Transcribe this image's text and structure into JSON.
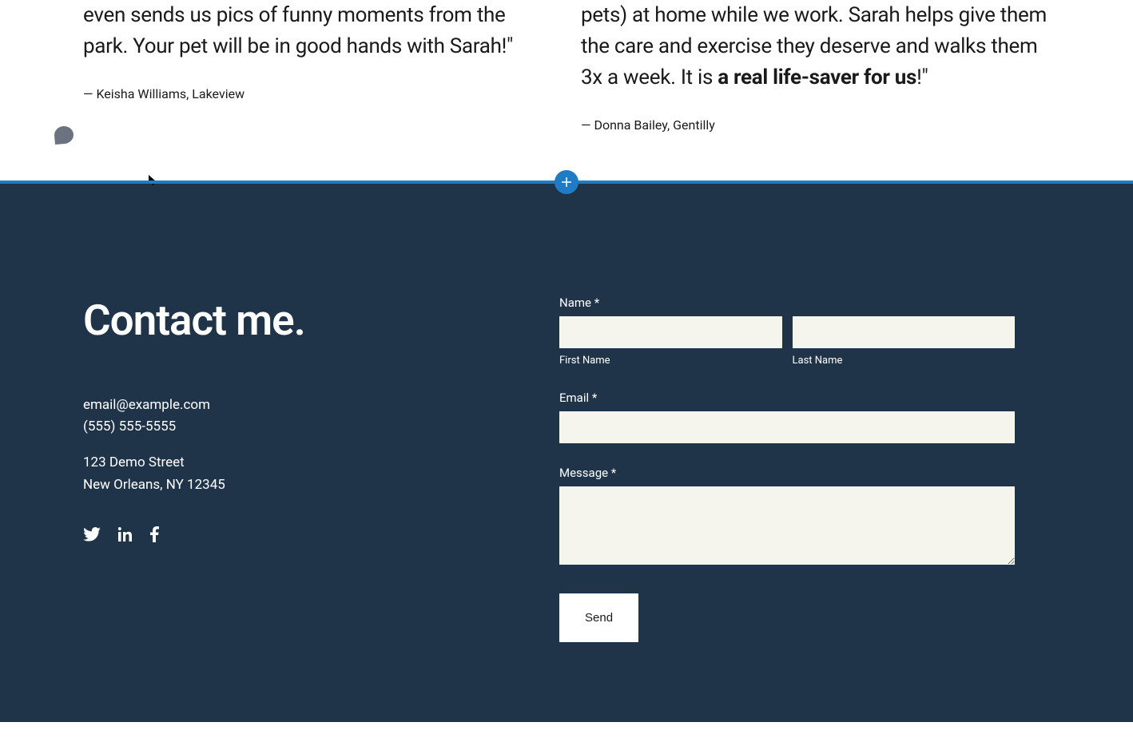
{
  "testimonials": {
    "left": {
      "text": "even sends us pics of funny moments from the park. Your pet will be in good hands with Sarah!\"",
      "author": "— Keisha Williams, Lakeview"
    },
    "right": {
      "text_prefix": "pets) at home while we work. Sarah helps give them the care and exercise they deserve and walks them 3x a week. It is ",
      "text_bold": "a real life-saver for us",
      "text_suffix": "!\"",
      "author": "— Donna Bailey, Gentilly"
    }
  },
  "contact": {
    "heading": "Contact me.",
    "email": "email@example.com",
    "phone": "(555) 555-5555",
    "address_line1": "123 Demo Street",
    "address_line2": "New Orleans, NY 12345",
    "form": {
      "name_label": "Name *",
      "first_name_label": "First Name",
      "last_name_label": "Last Name",
      "email_label": "Email *",
      "message_label": "Message *",
      "send_button": "Send"
    }
  }
}
